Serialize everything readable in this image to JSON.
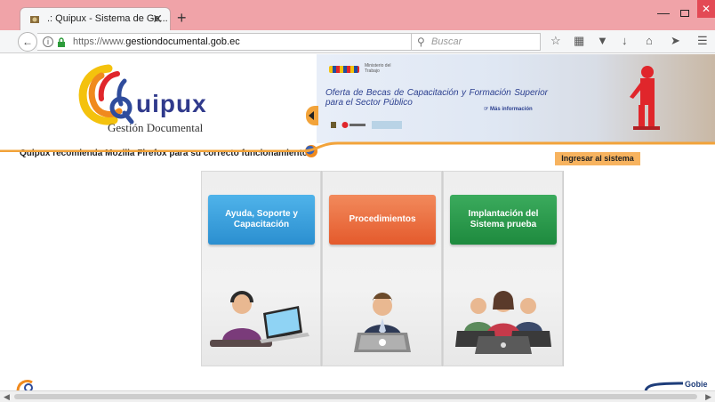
{
  "browser": {
    "tab_title": ".: Quipux - Sistema de Ge...",
    "tab_close": "✕",
    "new_tab": "+",
    "url_prefix": "https://www.",
    "url_domain": "gestiondocumental.gob.ec",
    "search_placeholder": "Buscar",
    "minimize": "—",
    "close": "✕"
  },
  "header": {
    "logo_text": "uipux",
    "logo_subtitle": "Gestión Documental",
    "recommendation": "Quipux recomienda Mozilla Firefox para su correcto funcionamiento",
    "ministerio": "Ministerio del Trabajo",
    "offer_text": "Oferta de Becas de Capacitación y Formación Superior para el Sector Público",
    "more_info": "Más información",
    "login_button": "Ingresar al sistema",
    "accent_color": "#f7a23a"
  },
  "tiles": [
    {
      "label": "Ayuda, Soporte y Capacitación",
      "color": "#2b8fd0"
    },
    {
      "label": "Procedimientos",
      "color": "#e45a2c"
    },
    {
      "label": "Implantación del Sistema prueba",
      "color": "#1e8a3e"
    }
  ],
  "footer": {
    "right_logo_text": "Gobie"
  }
}
